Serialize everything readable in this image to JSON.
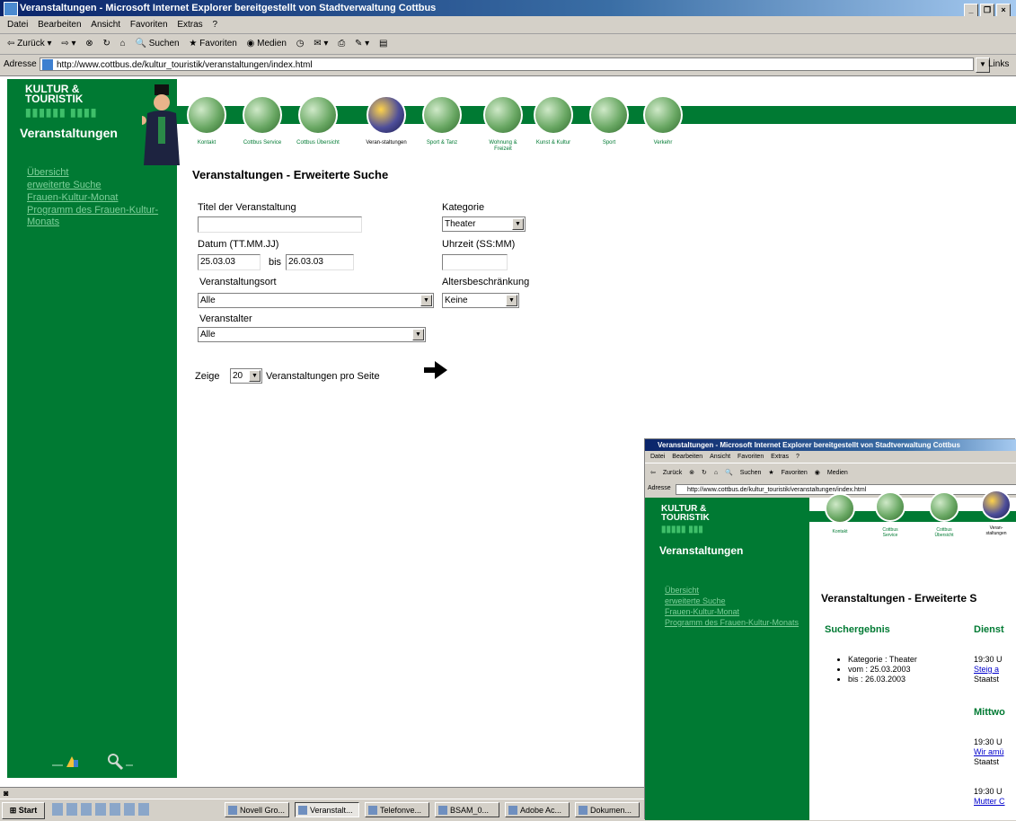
{
  "browser": {
    "title": "Veranstaltungen - Microsoft Internet Explorer bereitgestellt von Stadtverwaltung Cottbus",
    "menu": [
      "Datei",
      "Bearbeiten",
      "Ansicht",
      "Favoriten",
      "Extras",
      "?"
    ],
    "toolbar": [
      "Zurück",
      "Suchen",
      "Favoriten",
      "Medien"
    ],
    "address_label": "Adresse",
    "url": "http://www.cottbus.de/kultur_touristik/veranstaltungen/index.html",
    "links_label": "Links"
  },
  "sidebar": {
    "logo_line1": "KULTUR &",
    "logo_line2": "TOURISTIK",
    "section_title": "Veranstaltungen",
    "links": [
      "Übersicht",
      "erweiterte Suche",
      "Frauen-Kultur-Monat",
      "Programm des Frauen-Kultur-Monats"
    ]
  },
  "nav": {
    "items": [
      {
        "label": "Kontakt",
        "active": false
      },
      {
        "label": "Cottbus Service",
        "active": false
      },
      {
        "label": "Cottbus Übersicht",
        "active": false
      },
      {
        "label": "Veran-staltungen",
        "active": true
      },
      {
        "label": "Sport & Tanz",
        "active": false
      },
      {
        "label": "Wohnung & Freizeit",
        "active": false
      },
      {
        "label": "Kunst & Kultur",
        "active": false
      },
      {
        "label": "Sport",
        "active": false
      },
      {
        "label": "Verkehr",
        "active": false
      }
    ]
  },
  "form": {
    "page_title": "Veranstaltungen - Erweiterte Suche",
    "title_label": "Titel der Veranstaltung",
    "title_value": "",
    "category_label": "Kategorie",
    "category_value": "Theater",
    "date_label": "Datum (TT.MM.JJ)",
    "date_from": "25.03.03",
    "date_to_label": "bis",
    "date_to": "26.03.03",
    "time_label": "Uhrzeit (SS:MM)",
    "time_value": "",
    "venue_label": "Veranstaltungsort",
    "venue_value": "Alle",
    "age_label": "Altersbeschränkung",
    "age_value": "Keine",
    "organizer_label": "Veranstalter",
    "organizer_value": "Alle",
    "show_prefix": "Zeige",
    "per_page_value": "20",
    "show_suffix": "Veranstaltungen pro Seite"
  },
  "statusbar": {
    "text": ""
  },
  "taskbar": {
    "start_label": "Start",
    "tasks": [
      {
        "label": "Novell Gro...",
        "active": false
      },
      {
        "label": "Veranstalt...",
        "active": true
      },
      {
        "label": "Telefonve...",
        "active": false
      },
      {
        "label": "BSAM_0...",
        "active": false
      },
      {
        "label": "Adobe Ac...",
        "active": false
      },
      {
        "label": "Dokumen...",
        "active": false
      }
    ]
  },
  "inset": {
    "title": "Veranstaltungen - Microsoft Internet Explorer bereitgestellt von Stadtverwaltung Cottbus",
    "menu": [
      "Datei",
      "Bearbeiten",
      "Ansicht",
      "Favoriten",
      "Extras",
      "?"
    ],
    "toolbar": [
      "Zurück",
      "Suchen",
      "Favoriten",
      "Medien"
    ],
    "address_label": "Adresse",
    "url": "http://www.cottbus.de/kultur_touristik/veranstaltungen/index.html",
    "logo_line1": "KULTUR &",
    "logo_line2": "TOURISTIK",
    "section_title": "Veranstaltungen",
    "links": [
      "Übersicht",
      "erweiterte Suche",
      "Frauen-Kultur-Monat",
      "Programm des Frauen-Kultur-Monats"
    ],
    "nav_labels": [
      "Kontakt",
      "Cottbus Service",
      "Cottbus Übersicht",
      "Veran-staltungen"
    ],
    "page_title": "Veranstaltungen - Erweiterte S",
    "results_heading": "Suchergebnis",
    "criteria": [
      "Kategorie : Theater",
      "vom : 25.03.2003",
      "bis : 26.03.2003"
    ],
    "day1_heading": "Dienst",
    "day1_event": {
      "time": "19:30 U",
      "title": "Steig a",
      "place": "Staatst"
    },
    "day2_heading": "Mittwo",
    "day2_event": {
      "time": "19:30 U",
      "title": "Wir amü",
      "place": "Staatst"
    },
    "day3_event": {
      "time": "19:30 U",
      "title": "Mutter C"
    }
  }
}
